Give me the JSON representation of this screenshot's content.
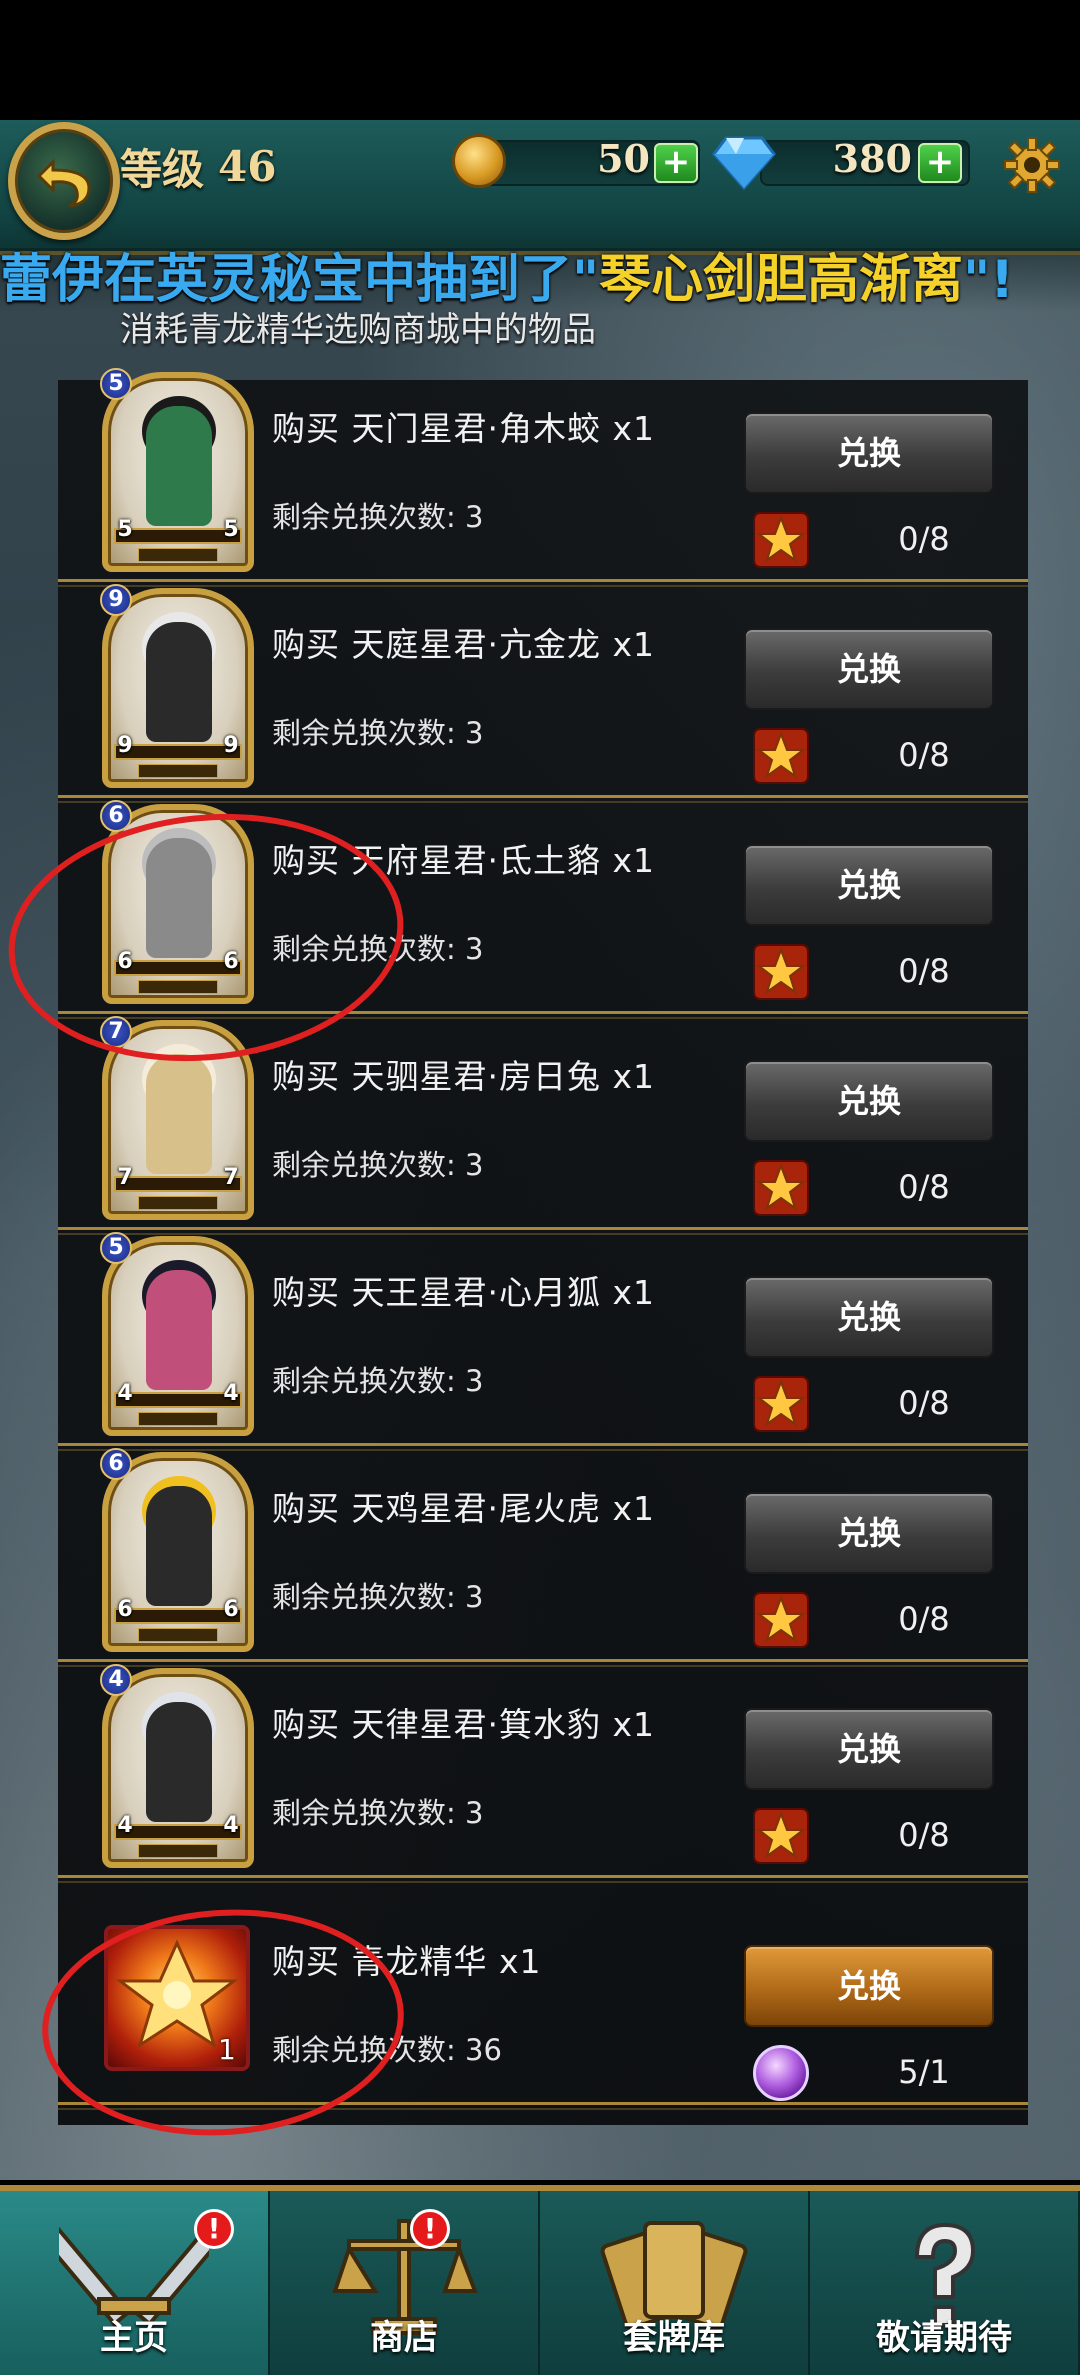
{
  "header": {
    "level_label": "等级",
    "level_value": "46",
    "gold": "50",
    "diamonds": "380",
    "plus_label": "+"
  },
  "broadcast": {
    "part1": "蕾伊在英灵秘宝中抽到了\"",
    "part2": "琴心剑胆高渐离",
    "part3": "\"!"
  },
  "subtitle": "消耗青龙精华选购商城中的物品",
  "items": [
    {
      "stars": "5",
      "corner": "5",
      "buy": "购买 天门星君·角木蛟 x1",
      "remain": "剩余兑换次数: 3",
      "btn": "兑换",
      "cost": "0/8",
      "hair": "#1a1a1a",
      "robe": "#2f7a4a"
    },
    {
      "stars": "9",
      "corner": "9",
      "buy": "购买 天庭星君·亢金龙 x1",
      "remain": "剩余兑换次数: 3",
      "btn": "兑换",
      "cost": "0/8",
      "hair": "#e8e8e8",
      "robe": "#2a2a2a"
    },
    {
      "stars": "6",
      "corner": "6",
      "buy": "购买 天府星君·氐土貉 x1",
      "remain": "剩余兑换次数: 3",
      "btn": "兑换",
      "cost": "0/8",
      "hair": "#bdbdbd",
      "robe": "#8a8a8a"
    },
    {
      "stars": "7",
      "corner": "7",
      "buy": "购买 天驷星君·房日兔 x1",
      "remain": "剩余兑换次数: 3",
      "btn": "兑换",
      "cost": "0/8",
      "hair": "#f4ecd8",
      "robe": "#d8c08a"
    },
    {
      "stars": "5",
      "corner": "4",
      "buy": "购买 天王星君·心月狐 x1",
      "remain": "剩余兑换次数: 3",
      "btn": "兑换",
      "cost": "0/8",
      "hair": "#1a1a2a",
      "robe": "#c0507a"
    },
    {
      "stars": "6",
      "corner": "6",
      "buy": "购买 天鸡星君·尾火虎 x1",
      "remain": "剩余兑换次数: 3",
      "btn": "兑换",
      "cost": "0/8",
      "hair": "#f0c020",
      "robe": "#2a2a2a"
    },
    {
      "stars": "4",
      "corner": "4",
      "buy": "购买 天律星君·箕水豹 x1",
      "remain": "剩余兑换次数: 3",
      "btn": "兑换",
      "cost": "0/8",
      "hair": "#e0e4ea",
      "robe": "#2a2a2a"
    }
  ],
  "essence_item": {
    "count": "1",
    "buy": "购买 青龙精华 x1",
    "remain": "剩余兑换次数: 36",
    "btn": "兑换",
    "cost": "5/1"
  },
  "nav": {
    "home": "主页",
    "shop": "商店",
    "deck": "套牌库",
    "coming": "敬请期待",
    "alert": "!"
  },
  "colors": {
    "accent_gold": "#b08a3a",
    "annotation_red": "#e02020",
    "teal_bar": "#1d5c5a"
  }
}
